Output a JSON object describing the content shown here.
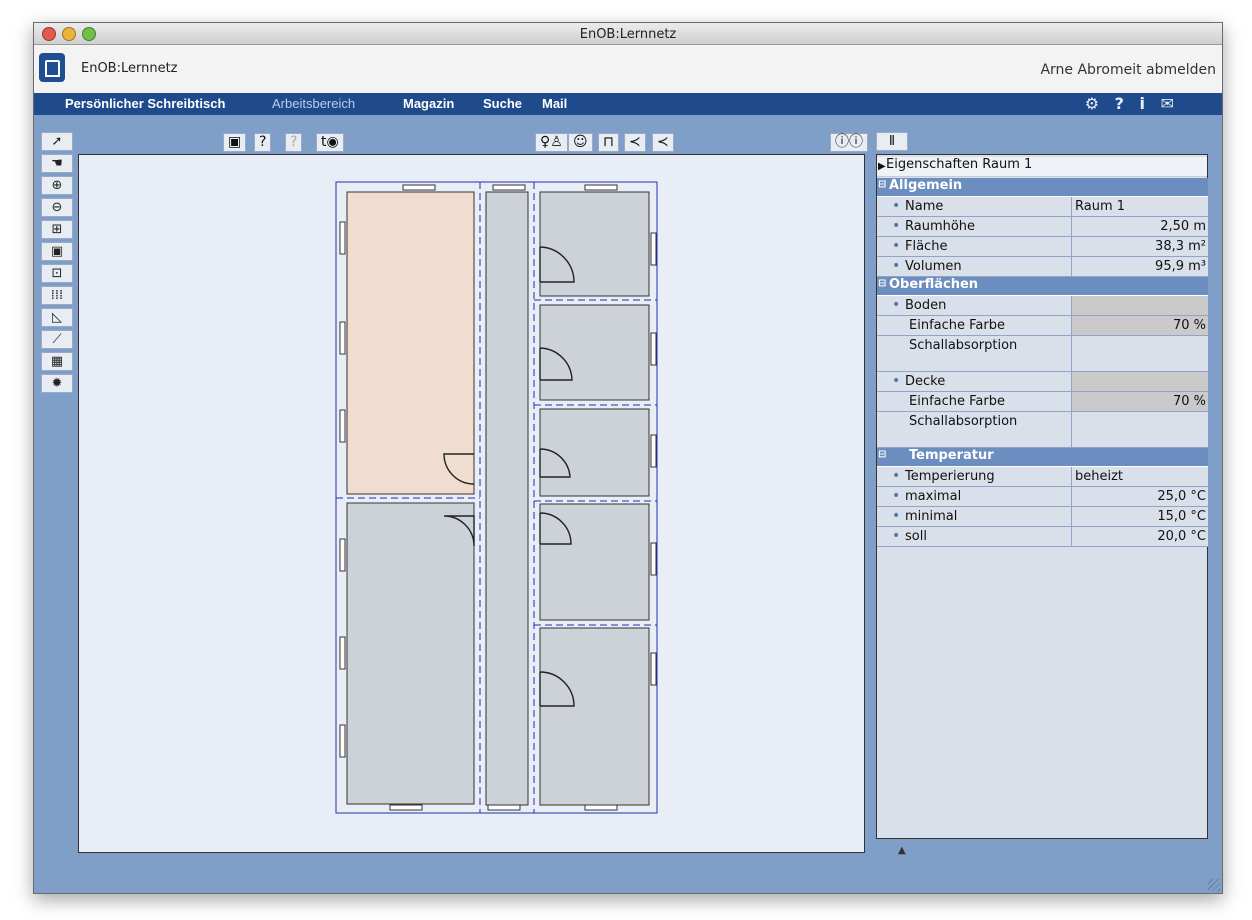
{
  "window": {
    "title": "EnOB:Lernnetz"
  },
  "app": {
    "title": "EnOB:Lernnetz",
    "logout": "Arne Abromeit abmelden"
  },
  "menu": {
    "items": [
      "Persönlicher Schreibtisch",
      "Arbeitsbereich",
      "Magazin",
      "Suche",
      "Mail"
    ],
    "active_index": 1,
    "icons": [
      "gear-icon",
      "help-icon",
      "info-icon",
      "mail-icon"
    ]
  },
  "toolbar": {
    "left": [
      "select-arrow-icon",
      "pan-hand-icon",
      "zoom-in-icon",
      "zoom-out-icon",
      "fit-icon",
      "zoom-window-icon",
      "snap-icon",
      "grid-icon",
      "angle-icon",
      "wall-tool-icon",
      "pattern-icon",
      "settings-icon"
    ],
    "top": [
      "save-icon",
      "help-icon",
      "help-disabled-icon",
      "north-view-icon",
      "people-icon",
      "figure-icon",
      "table-icon",
      "stair-icon",
      "roof-icon",
      "info-toggle-icon"
    ],
    "top_labels": {
      "help": "?",
      "help_disabled": "?"
    }
  },
  "properties": {
    "title": "Eigenschaften Raum 1",
    "sections": {
      "general": "Allgemein",
      "surfaces": "Oberflächen",
      "temperature": "Temperatur"
    },
    "general": [
      {
        "key": "Name",
        "value": "Raum 1"
      },
      {
        "key": "Raumhöhe",
        "value": "2,50 m"
      },
      {
        "key": "Fläche",
        "value": "38,3 m²"
      },
      {
        "key": "Volumen",
        "value": "95,9 m³"
      }
    ],
    "surfaces": {
      "floor": {
        "label": "Boden",
        "color_label": "Einfache Farbe",
        "color_value": "70 %",
        "absorption_label": "Schallabsorption"
      },
      "ceiling": {
        "label": "Decke",
        "color_label": "Einfache Farbe",
        "color_value": "70 %",
        "absorption_label": "Schallabsorption"
      }
    },
    "temperature": [
      {
        "key": "Temperierung",
        "value": "beheizt"
      },
      {
        "key": "maximal",
        "value": "25,0 °C"
      },
      {
        "key": "minimal",
        "value": "15,0 °C"
      },
      {
        "key": "soll",
        "value": "20,0 °C"
      }
    ]
  },
  "colors": {
    "selected_room": "#f0ddd0",
    "room": "#cdd2d8",
    "menubar": "#1f4b8c",
    "section": "#6c8dbf"
  }
}
